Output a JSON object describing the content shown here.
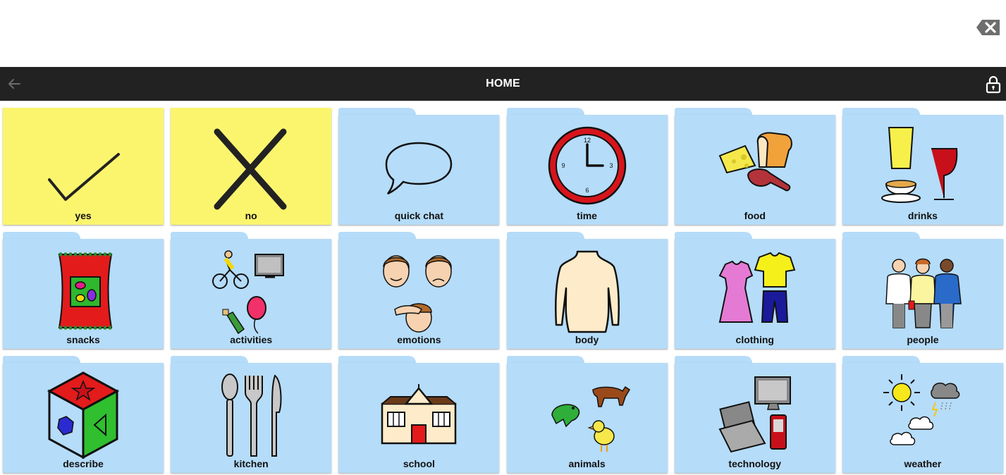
{
  "output": {
    "backspace_icon": "backspace-icon"
  },
  "header": {
    "title": "HOME",
    "back_icon": "back-arrow-icon",
    "lock_icon": "lock-icon"
  },
  "colors": {
    "navbar": "#222222",
    "yes_no_tile": "#fbf56e",
    "folder_tile": "#b5dcf9"
  },
  "tiles": [
    {
      "label": "yes",
      "icon": "checkmark-icon",
      "kind": "button"
    },
    {
      "label": "no",
      "icon": "cross-icon",
      "kind": "button"
    },
    {
      "label": "quick chat",
      "icon": "speech-bubble-icon",
      "kind": "folder"
    },
    {
      "label": "time",
      "icon": "clock-icon",
      "kind": "folder"
    },
    {
      "label": "food",
      "icon": "food-icon",
      "kind": "folder"
    },
    {
      "label": "drinks",
      "icon": "drinks-icon",
      "kind": "folder"
    },
    {
      "label": "snacks",
      "icon": "snack-bag-icon",
      "kind": "folder"
    },
    {
      "label": "activities",
      "icon": "activities-icon",
      "kind": "folder"
    },
    {
      "label": "emotions",
      "icon": "faces-icon",
      "kind": "folder"
    },
    {
      "label": "body",
      "icon": "torso-icon",
      "kind": "folder"
    },
    {
      "label": "clothing",
      "icon": "clothes-icon",
      "kind": "folder"
    },
    {
      "label": "people",
      "icon": "people-icon",
      "kind": "folder"
    },
    {
      "label": "describe",
      "icon": "shape-cube-icon",
      "kind": "folder"
    },
    {
      "label": "kitchen",
      "icon": "cutlery-icon",
      "kind": "folder"
    },
    {
      "label": "school",
      "icon": "school-building-icon",
      "kind": "folder"
    },
    {
      "label": "animals",
      "icon": "animals-icon",
      "kind": "folder"
    },
    {
      "label": "technology",
      "icon": "devices-icon",
      "kind": "folder"
    },
    {
      "label": "weather",
      "icon": "weather-icon",
      "kind": "folder"
    }
  ],
  "clock_numbers": [
    "12",
    "3",
    "6",
    "9"
  ]
}
